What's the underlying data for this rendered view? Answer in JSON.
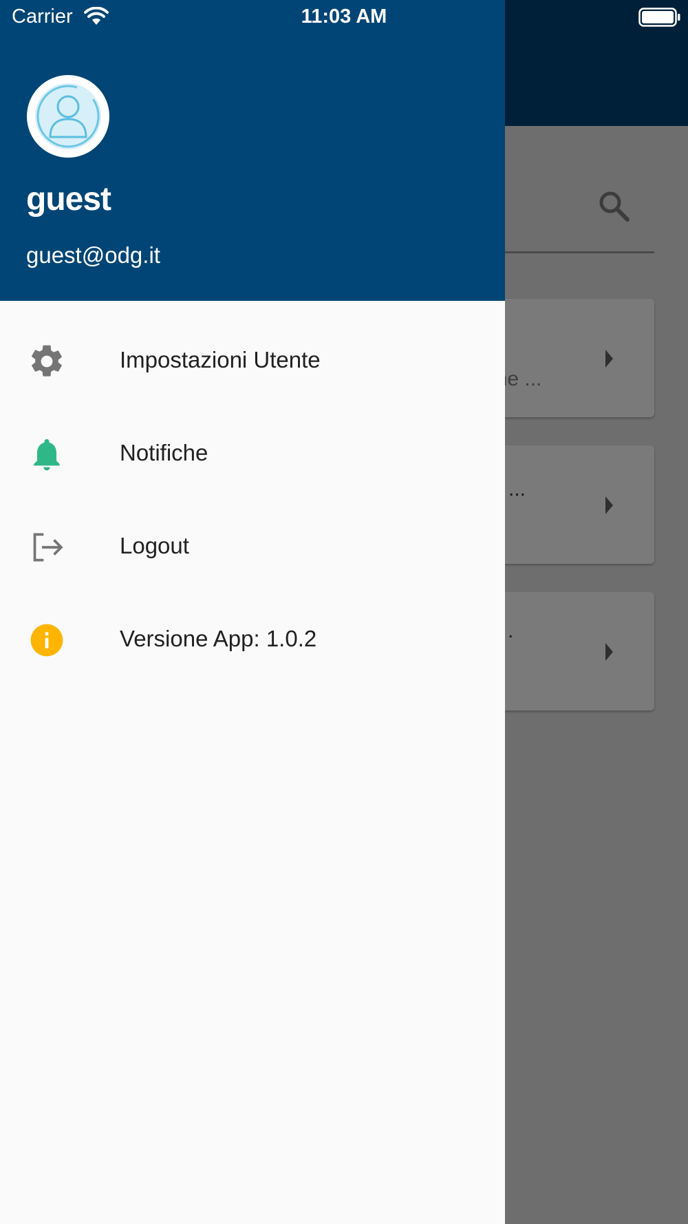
{
  "status_bar": {
    "carrier": "Carrier",
    "time": "11:03 AM",
    "icons": [
      "wifi-icon",
      "battery-icon"
    ]
  },
  "drawer": {
    "user": {
      "name": "guest",
      "email": "guest@odg.it",
      "avatar_icon": "user-avatar-icon"
    },
    "menu": [
      {
        "label": "Impostazioni Utente",
        "icon": "gear-icon",
        "icon_color": "#757575"
      },
      {
        "label": "Notifiche",
        "icon": "bell-icon",
        "icon_color": "#2eb887"
      },
      {
        "label": "Logout",
        "icon": "logout-icon",
        "icon_color": "#757575"
      },
      {
        "label": "Versione App: 1.0.2",
        "icon": "info-icon",
        "icon_color": "#ffb400"
      }
    ],
    "colors": {
      "header": "#004575",
      "background": "#fafafa"
    }
  },
  "background_app": {
    "search_icon": "search-icon",
    "cards": [
      {
        "snippet": "one ..."
      },
      {
        "snippet": "re ..."
      },
      {
        "snippet": "."
      }
    ]
  }
}
